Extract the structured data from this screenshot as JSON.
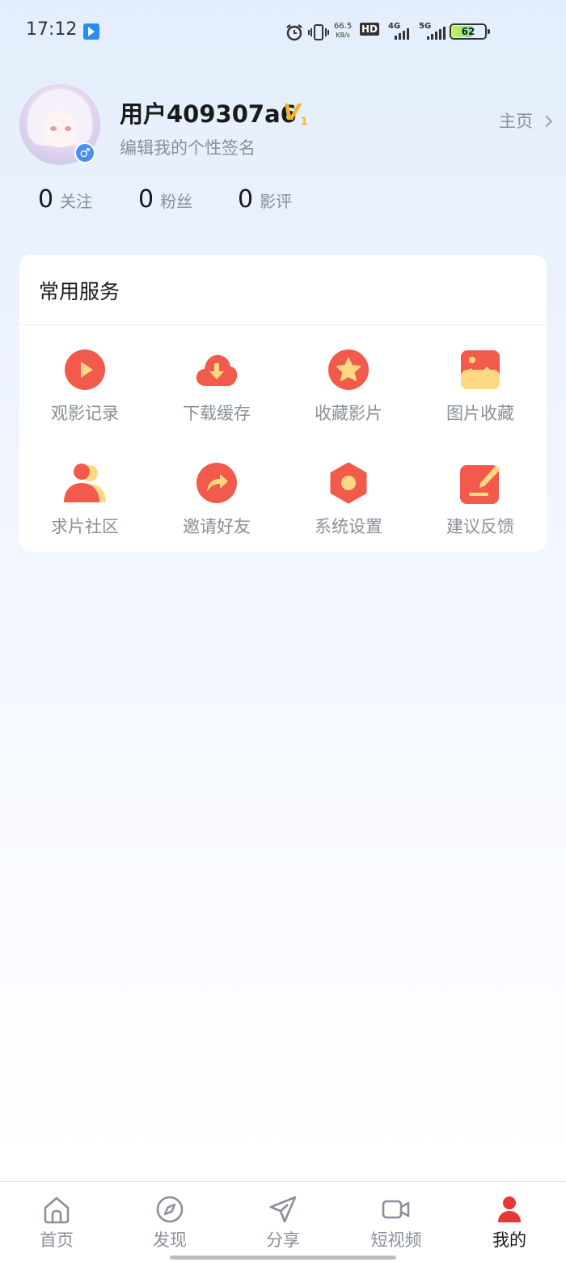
{
  "status_bar": {
    "time": "17:12",
    "net_speed": "66.5",
    "net_unit": "KB/s",
    "hd_label": "HD",
    "sim1_type": "4G",
    "sim2_type": "5G",
    "battery": "62"
  },
  "profile": {
    "username": "用户409307a6",
    "vip_badge": "V",
    "vip_level": "1",
    "signature": "编辑我的个性签名",
    "home_link": "主页",
    "gender_symbol": "♂"
  },
  "stats": [
    {
      "value": "0",
      "label": "关注"
    },
    {
      "value": "0",
      "label": "粉丝"
    },
    {
      "value": "0",
      "label": "影评"
    }
  ],
  "services": {
    "title": "常用服务",
    "items": [
      {
        "label": "观影记录",
        "icon": "play-icon"
      },
      {
        "label": "下载缓存",
        "icon": "download-cloud-icon"
      },
      {
        "label": "收藏影片",
        "icon": "star-icon"
      },
      {
        "label": "图片收藏",
        "icon": "image-icon"
      },
      {
        "label": "求片社区",
        "icon": "community-icon"
      },
      {
        "label": "邀请好友",
        "icon": "share-arrow-icon"
      },
      {
        "label": "系统设置",
        "icon": "settings-hex-icon"
      },
      {
        "label": "建议反馈",
        "icon": "edit-icon"
      }
    ]
  },
  "tabbar": {
    "tabs": [
      {
        "label": "首页",
        "icon": "home-icon"
      },
      {
        "label": "发现",
        "icon": "compass-icon"
      },
      {
        "label": "分享",
        "icon": "send-icon"
      },
      {
        "label": "短视频",
        "icon": "video-icon"
      },
      {
        "label": "我的",
        "icon": "user-icon"
      }
    ],
    "active_index": 4
  },
  "colors": {
    "accent": "#f25b4b",
    "accent_yellow": "#ffd884",
    "active_tab": "#e53935",
    "muted_text": "#8a8f99"
  }
}
